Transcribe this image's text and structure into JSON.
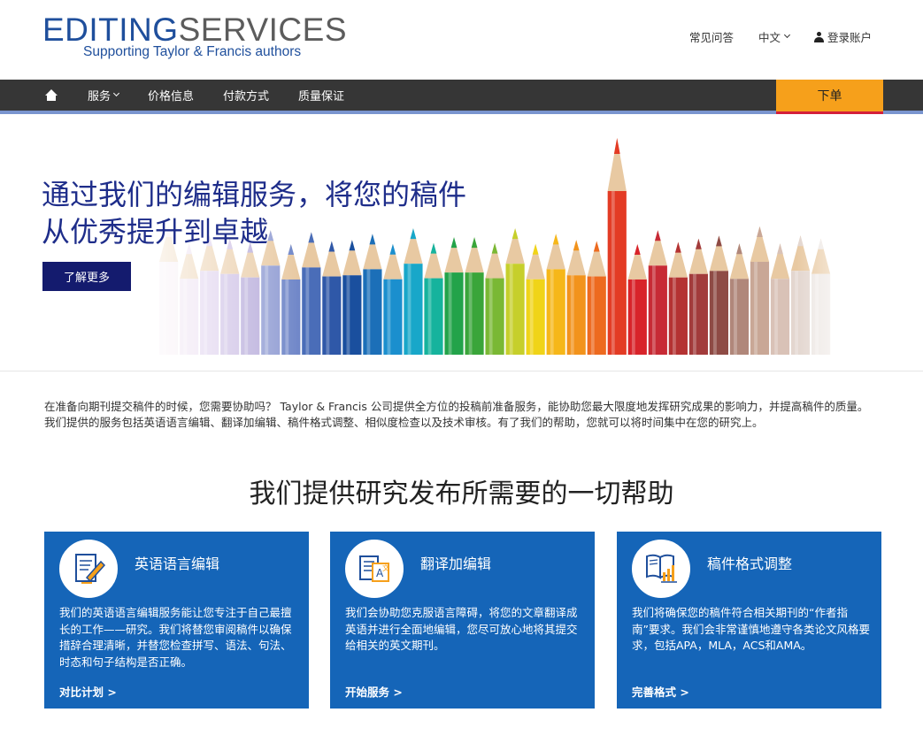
{
  "logo": {
    "part1": "EDITING",
    "part2": "SERVICES",
    "tagline": "Supporting Taylor & Francis authors"
  },
  "top_links": {
    "faq": "常见问答",
    "language": "中文",
    "login": "登录账户"
  },
  "nav": {
    "items": [
      {
        "label": "服务",
        "dropdown": true
      },
      {
        "label": "价格信息"
      },
      {
        "label": "付款方式"
      },
      {
        "label": "质量保证"
      }
    ],
    "order_button": "下单"
  },
  "hero": {
    "title_line1": "通过我们的编辑服务，将您的稿件",
    "title_line2": "从优秀提升到卓越",
    "button": "了解更多"
  },
  "intro": "在准备向期刊提交稿件的时候，您需要协助吗？ Taylor & Francis 公司提供全方位的投稿前准备服务，能协助您最大限度地发挥研究成果的影响力，并提高稿件的质量。我们提供的服务包括英语语言编辑、翻译加编辑、稿件格式调整、相似度检查以及技术审核。有了我们的帮助，您就可以将时间集中在您的研究上。",
  "section_title": "我们提供研究发布所需要的一切帮助",
  "cards": [
    {
      "title": "英语语言编辑",
      "text": "我们的英语语言编辑服务能让您专注于自己最擅长的工作——研究。我们将替您审阅稿件以确保措辞合理清晰，并替您检查拼写、语法、句法、时态和句子结构是否正确。",
      "link": "对比计划 >",
      "icon": "edit-document-icon"
    },
    {
      "title": "翻译加编辑",
      "text": "我们会协助您克服语言障碍，将您的文章翻译成英语并进行全面地编辑，您尽可放心地将其提交给相关的英文期刊。",
      "link": "开始服务 >",
      "icon": "translate-document-icon"
    },
    {
      "title": "稿件格式调整",
      "text": "我们将确保您的稿件符合相关期刊的“作者指南”要求。我们会非常谨慎地遵守各类论文风格要求，包括APA，MLA，ACS和AMA。",
      "link": "完善格式 >",
      "icon": "book-chart-icon"
    }
  ],
  "colors": {
    "brand_blue": "#1f4f9c",
    "nav_bg": "#363636",
    "order_orange": "#f6a01b",
    "hero_title": "#1e2d8a",
    "card_blue": "#1565b8"
  },
  "pencil_colors": [
    "#f3e6f0",
    "#e8d8ee",
    "#d8c8ea",
    "#c7b8e2",
    "#b4a8d9",
    "#8e9ad2",
    "#6f86c8",
    "#4a6db8",
    "#2f58a8",
    "#1a4f9e",
    "#1c6fb8",
    "#1b8fce",
    "#18a7c9",
    "#16b39d",
    "#23a34a",
    "#3aa53a",
    "#7ab834",
    "#c6cf2b",
    "#f0d418",
    "#f6b719",
    "#f2931c",
    "#ed6a1f",
    "#e33b24",
    "#d8232a",
    "#c72a35",
    "#b43232",
    "#a23b3b",
    "#8e4b45",
    "#b0877a",
    "#c9a796",
    "#d9c2b7",
    "#e3d6cf",
    "#ece6e2"
  ]
}
